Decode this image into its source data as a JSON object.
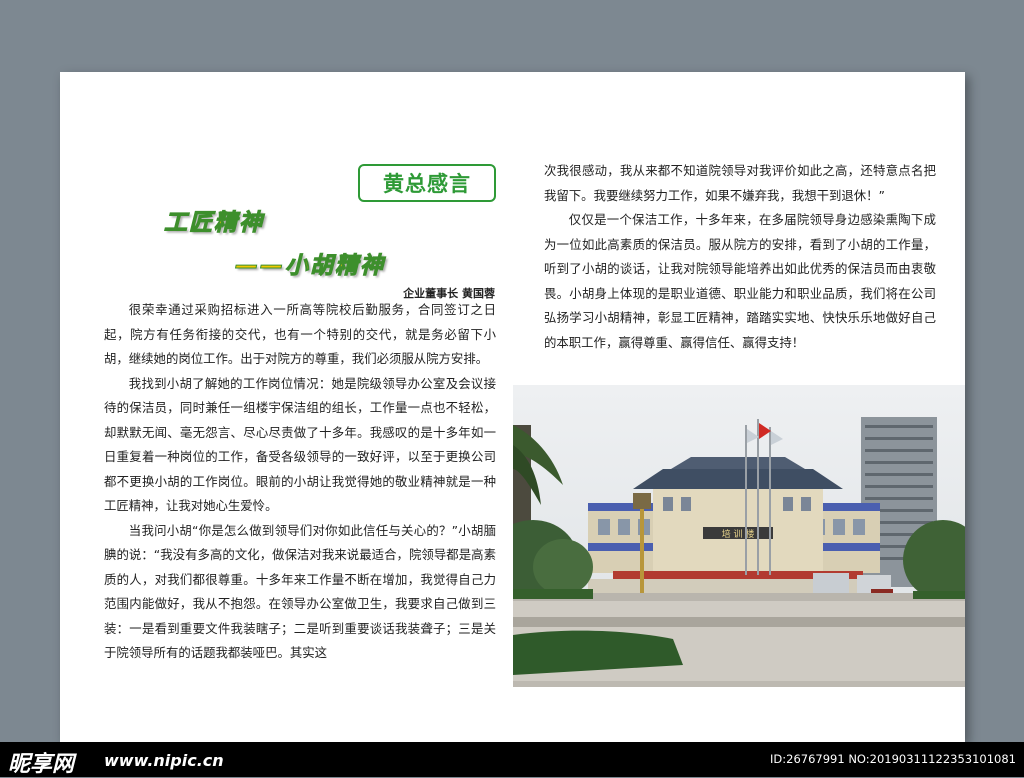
{
  "badge": "黄总感言",
  "title_main": "工匠精神",
  "title_sub": "——小胡精神",
  "author": "企业董事长  黄国蓉",
  "left_paragraphs": [
    "很荣幸通过采购招标进入一所高等院校后勤服务，合同签订之日起，院方有任务衔接的交代，也有一个特别的交代，就是务必留下小胡，继续她的岗位工作。出于对院方的尊重，我们必须服从院方安排。",
    "我找到小胡了解她的工作岗位情况：她是院级领导办公室及会议接待的保洁员，同时兼任一组楼宇保洁组的组长，工作量一点也不轻松，却默默无闻、毫无怨言、尽心尽责做了十多年。我感叹的是十多年如一日重复着一种岗位的工作，备受各级领导的一致好评，以至于更换公司都不更换小胡的工作岗位。眼前的小胡让我觉得她的敬业精神就是一种工匠精神，让我对她心生爱怜。",
    "当我问小胡“你是怎么做到领导们对你如此信任与关心的？”小胡腼腆的说：“我没有多高的文化，做保洁对我来说最适合，院领导都是高素质的人，对我们都很尊重。十多年来工作量不断在增加，我觉得自己力范围内能做好，我从不抱怨。在领导办公室做卫生，我要求自己做到三装：一是看到重要文件我装瞎子；二是听到重要谈话我装聋子；三是关于院领导所有的话题我都装哑巴。其实这"
  ],
  "right_paragraphs": [
    "次我很感动，我从来都不知道院领导对我评价如此之高，还特意点名把我留下。我要继续努力工作，如果不嫌弃我，我想干到退休！”",
    "仅仅是一个保洁工作，十多年来，在多届院领导身边感染熏陶下成为一位如此高素质的保洁员。服从院方的安排，看到了小胡的工作量，听到了小胡的谈话，让我对院领导能培养出如此优秀的保洁员而由衷敬畏。小胡身上体现的是职业道德、职业能力和职业品质，我们将在公司弘扬学习小胡精神，彰显工匠精神，踏踏实实地、快快乐乐地做好自己的本职工作，赢得尊重、赢得信任、赢得支持！"
  ],
  "building_sign": "培 训 楼",
  "watermark": {
    "logo": "昵享网",
    "url": "www.nipic.cn",
    "id": "ID:26767991 NO:20190311122353101081"
  }
}
